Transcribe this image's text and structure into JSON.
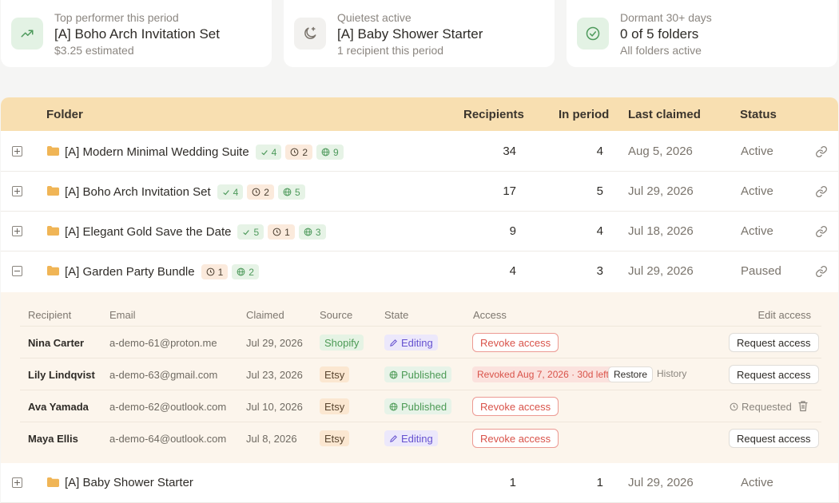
{
  "summary": [
    {
      "label": "Top performer this period",
      "value": "[A] Boho Arch Invitation Set",
      "sub": "$3.25 estimated",
      "icon": "trending-up-icon"
    },
    {
      "label": "Quietest active",
      "value": "[A] Baby Shower Starter",
      "sub": "1 recipient this period",
      "icon": "moon-icon"
    },
    {
      "label": "Dormant 30+ days",
      "value": "0 of 5 folders",
      "sub": "All folders active",
      "icon": "check-circle-icon"
    }
  ],
  "table": {
    "headers": {
      "folder": "Folder",
      "recipients": "Recipients",
      "in_period": "In period",
      "last_claimed": "Last claimed",
      "status": "Status"
    },
    "rows": [
      {
        "name": "[A] Modern Minimal Wedding Suite",
        "check": "4",
        "clock": "2",
        "globe": "9",
        "recipients": "34",
        "in_period": "4",
        "last_claimed": "Aug 5, 2026",
        "status": "Active"
      },
      {
        "name": "[A] Boho Arch Invitation Set",
        "check": "4",
        "clock": "2",
        "globe": "5",
        "recipients": "17",
        "in_period": "5",
        "last_claimed": "Jul 29, 2026",
        "status": "Active"
      },
      {
        "name": "[A] Elegant Gold Save the Date",
        "check": "5",
        "clock": "1",
        "globe": "3",
        "recipients": "9",
        "in_period": "4",
        "last_claimed": "Jul 18, 2026",
        "status": "Active"
      },
      {
        "name": "[A] Garden Party Bundle",
        "clock": "1",
        "globe": "2",
        "recipients": "4",
        "in_period": "3",
        "last_claimed": "Jul 29, 2026",
        "status": "Paused"
      },
      {
        "name": "[A] Baby Shower Starter",
        "recipients": "1",
        "in_period": "1",
        "last_claimed": "Jul 29, 2026",
        "status": "Active"
      }
    ]
  },
  "expanded": {
    "headers": {
      "recipient": "Recipient",
      "email": "Email",
      "claimed": "Claimed",
      "source": "Source",
      "state": "State",
      "access": "Access",
      "edit_access": "Edit access"
    },
    "rows": [
      {
        "name": "Nina Carter",
        "email": "a-demo-61@proton.me",
        "claimed": "Jul 29, 2026",
        "source": "Shopify",
        "state": "Editing",
        "access_button": "Revoke access",
        "edit_button": "Request access"
      },
      {
        "name": "Lily Lindqvist",
        "email": "a-demo-63@gmail.com",
        "claimed": "Jul 23, 2026",
        "source": "Etsy",
        "state": "Published",
        "revoked": "Revoked Aug 7, 2026 · 30d left",
        "restore": "Restore",
        "history": "History",
        "edit_button": "Request access"
      },
      {
        "name": "Ava Yamada",
        "email": "a-demo-62@outlook.com",
        "claimed": "Jul 10, 2026",
        "source": "Etsy",
        "state": "Published",
        "access_button": "Revoke access",
        "requested": "Requested"
      },
      {
        "name": "Maya Ellis",
        "email": "a-demo-64@outlook.com",
        "claimed": "Jul 8, 2026",
        "source": "Etsy",
        "state": "Editing",
        "access_button": "Revoke access",
        "edit_button": "Request access"
      }
    ]
  },
  "colors": {
    "header_bg": "#f8dfb1",
    "folder": "#f0b556",
    "green": "#4e9a5c",
    "red": "#d9534a",
    "purple": "#6551cf"
  }
}
